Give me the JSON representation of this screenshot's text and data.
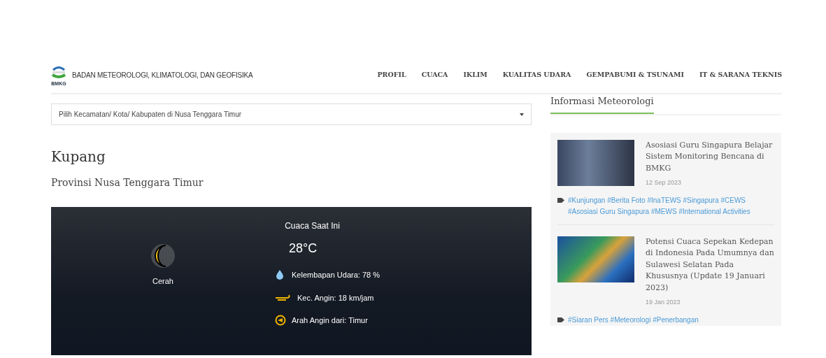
{
  "header": {
    "logo_text": "BMKG",
    "org_name": "BADAN METEOROLOGI, KLIMATOLOGI, DAN GEOFISIKA"
  },
  "nav": [
    {
      "label": "PROFIL"
    },
    {
      "label": "CUACA"
    },
    {
      "label": "IKLIM"
    },
    {
      "label": "KUALITAS UDARA"
    },
    {
      "label": "GEMPABUMI & TSUNAMI"
    },
    {
      "label": "IT & SARANA TEKNIS"
    }
  ],
  "location_select": {
    "value": "Pilih Kecamatan/ Kota/ Kabupaten di Nusa Tenggara Timur"
  },
  "city": "Kupang",
  "province": "Provinsi Nusa Tenggara Timur",
  "weather": {
    "title": "Cuaca Saat Ini",
    "condition": "Cerah",
    "temperature": "28°C",
    "details": [
      {
        "kind": "humidity",
        "text": "Kelembapan Udara: 78 %"
      },
      {
        "kind": "wind_speed",
        "text": "Kec. Angin: 18 km/jam"
      },
      {
        "kind": "wind_direction",
        "text": "Arah Angin dari: Timur"
      }
    ]
  },
  "sidebar": {
    "title": "Informasi Meteorologi",
    "articles": [
      {
        "kind": "photo",
        "title": "Asosiasi Guru Singapura Belajar Sistem Monitoring Bencana di BMKG",
        "date": "12 Sep 2023",
        "tags": "#Kunjungan #Berita Foto #InaTEWS #Singapura #CEWS #Asosiasi Guru Singapura #MEWS #International Activities"
      },
      {
        "kind": "map",
        "title": "Potensi Cuaca Sepekan Kedepan di Indonesia Pada Umumnya dan Sulawesi Selatan Pada Khususnya (Update 19 Januari 2023)",
        "date": "19 Jan 2023",
        "tags": "#Siaran Pers #Meteorologi #Penerbangan"
      }
    ]
  }
}
